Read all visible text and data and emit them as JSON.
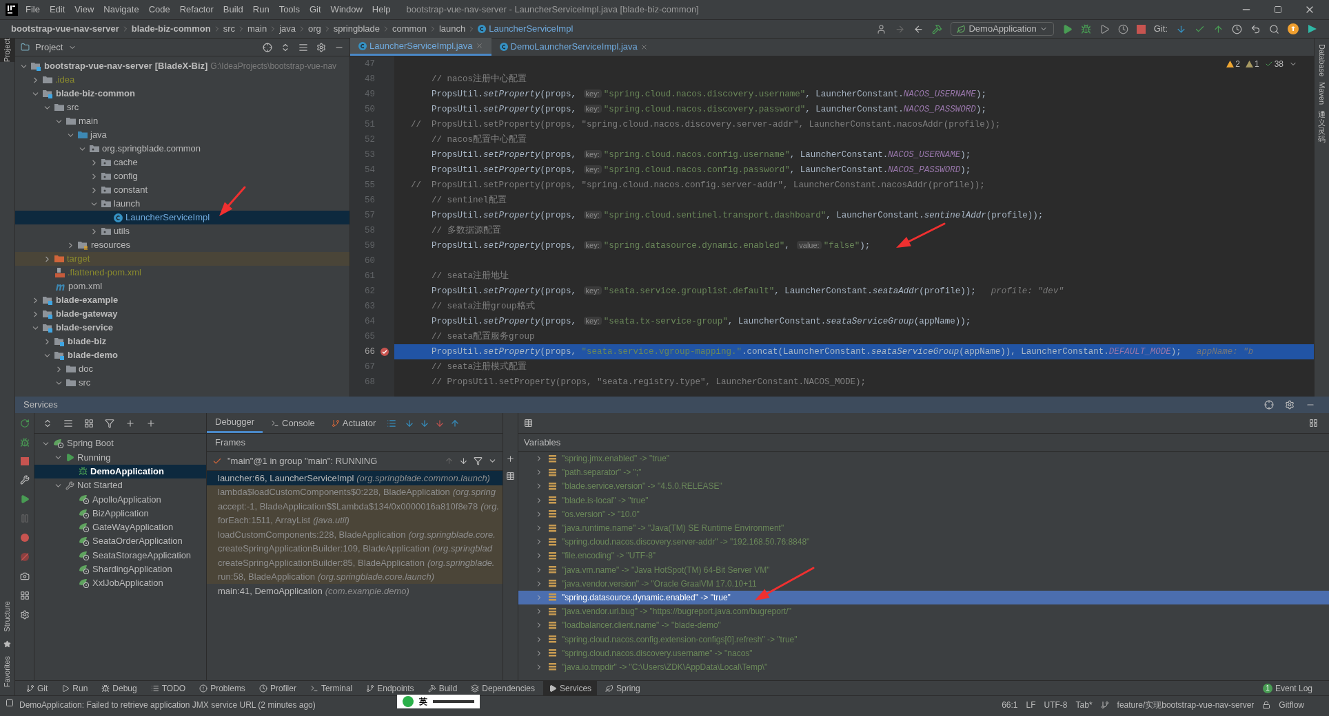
{
  "menu": [
    "File",
    "Edit",
    "View",
    "Navigate",
    "Code",
    "Refactor",
    "Build",
    "Run",
    "Tools",
    "Git",
    "Window",
    "Help"
  ],
  "window": {
    "title": "bootstrap-vue-nav-server - LauncherServiceImpl.java [blade-biz-common]"
  },
  "breadcrumbs": [
    {
      "label": "bootstrap-vue-nav-server",
      "kind": "module"
    },
    {
      "label": "blade-biz-common",
      "kind": "module"
    },
    {
      "label": "src",
      "kind": "dir"
    },
    {
      "label": "main",
      "kind": "dir"
    },
    {
      "label": "java",
      "kind": "dir"
    },
    {
      "label": "org",
      "kind": "dir"
    },
    {
      "label": "springblade",
      "kind": "dir"
    },
    {
      "label": "common",
      "kind": "dir"
    },
    {
      "label": "launch",
      "kind": "dir"
    },
    {
      "label": "LauncherServiceImpl",
      "kind": "class"
    }
  ],
  "run_config": "DemoApplication",
  "git_label": "Git:",
  "side_left": [
    "Project",
    "Structure",
    "Favorites"
  ],
  "side_right": [
    {
      "label": "Database",
      "kind": "latin"
    },
    {
      "label": "Maven",
      "kind": "latin"
    },
    {
      "label": "通义灵码",
      "kind": "cjk"
    }
  ],
  "project": {
    "title": "Project",
    "tree": [
      {
        "label": "bootstrap-vue-nav-server",
        "tag": "[BladeX-Biz]",
        "path": "G:\\IdeaProjects\\bootstrap-vue-nav",
        "kind": "module",
        "expanded": true,
        "selected": false,
        "children": [
          {
            "label": ".idea",
            "kind": "ignored",
            "expanded": false,
            "selected": false
          },
          {
            "label": "blade-biz-common",
            "kind": "module",
            "expanded": true,
            "selected": false,
            "children": [
              {
                "label": "src",
                "kind": "folder",
                "expanded": true,
                "selected": false,
                "children": [
                  {
                    "label": "main",
                    "kind": "folder",
                    "expanded": true,
                    "selected": false,
                    "children": [
                      {
                        "label": "java",
                        "kind": "source",
                        "expanded": true,
                        "selected": false,
                        "children": [
                          {
                            "label": "org.springblade.common",
                            "kind": "package",
                            "expanded": true,
                            "selected": false,
                            "children": [
                              {
                                "label": "cache",
                                "kind": "package",
                                "expanded": false,
                                "selected": false
                              },
                              {
                                "label": "config",
                                "kind": "package",
                                "expanded": false,
                                "selected": false
                              },
                              {
                                "label": "constant",
                                "kind": "package",
                                "expanded": false,
                                "selected": false
                              },
                              {
                                "label": "launch",
                                "kind": "package",
                                "expanded": true,
                                "selected": false,
                                "children": [
                                  {
                                    "label": "LauncherServiceImpl",
                                    "kind": "class",
                                    "selected": true
                                  }
                                ]
                              },
                              {
                                "label": "utils",
                                "kind": "package",
                                "expanded": false,
                                "selected": false
                              }
                            ]
                          }
                        ]
                      },
                      {
                        "label": "resources",
                        "kind": "resources",
                        "expanded": false,
                        "selected": false
                      }
                    ]
                  }
                ]
              },
              {
                "label": "target",
                "kind": "excluded",
                "expanded": false,
                "selected": false
              },
              {
                "label": ".flattened-pom.xml",
                "kind": "xml",
                "selected": false
              },
              {
                "label": "pom.xml",
                "kind": "maven",
                "selected": false
              }
            ]
          },
          {
            "label": "blade-example",
            "kind": "module",
            "expanded": false,
            "selected": false
          },
          {
            "label": "blade-gateway",
            "kind": "module",
            "expanded": false,
            "selected": false
          },
          {
            "label": "blade-service",
            "kind": "module",
            "expanded": true,
            "selected": false,
            "children": [
              {
                "label": "blade-biz",
                "kind": "module",
                "expanded": false,
                "selected": false
              },
              {
                "label": "blade-demo",
                "kind": "module",
                "expanded": true,
                "selected": false,
                "children": [
                  {
                    "label": "doc",
                    "kind": "folder",
                    "expanded": false,
                    "selected": false
                  },
                  {
                    "label": "src",
                    "kind": "folder",
                    "expanded": true,
                    "selected": false
                  }
                ]
              }
            ]
          }
        ]
      }
    ]
  },
  "editor": {
    "tabs": [
      {
        "label": "LauncherServiceImpl.java",
        "selected": true
      },
      {
        "label": "DemoLauncherServiceImpl.java",
        "selected": false
      }
    ],
    "inspections": [
      {
        "count": "2",
        "kind": "warning"
      },
      {
        "count": "1",
        "kind": "weak"
      },
      {
        "count": "38",
        "kind": "ok"
      }
    ],
    "lines": [
      {
        "n": "47",
        "breakpoint": false,
        "selected": false
      },
      {
        "n": "48",
        "breakpoint": false,
        "selected": false,
        "segs": [
          {
            "t": "    // nacos注册中心配置",
            "kind": "comment"
          }
        ]
      },
      {
        "n": "49",
        "breakpoint": false,
        "selected": false,
        "segs": [
          {
            "t": "    PropsUtil.",
            "kind": "plain"
          },
          {
            "t": "setProperty",
            "kind": "method"
          },
          {
            "t": "(props, ",
            "kind": "plain"
          },
          {
            "t": "key:",
            "kind": "hint"
          },
          {
            "t": "\"spring.cloud.nacos.discovery.username\"",
            "kind": "string"
          },
          {
            "t": ", LauncherConstant.",
            "kind": "plain"
          },
          {
            "t": "NACOS_USERNAME",
            "kind": "const"
          },
          {
            "t": ");",
            "kind": "plain"
          }
        ]
      },
      {
        "n": "50",
        "breakpoint": false,
        "selected": false,
        "segs": [
          {
            "t": "    PropsUtil.",
            "kind": "plain"
          },
          {
            "t": "setProperty",
            "kind": "method"
          },
          {
            "t": "(props, ",
            "kind": "plain"
          },
          {
            "t": "key:",
            "kind": "hint"
          },
          {
            "t": "\"spring.cloud.nacos.discovery.password\"",
            "kind": "string"
          },
          {
            "t": ", LauncherConstant.",
            "kind": "plain"
          },
          {
            "t": "NACOS_PASSWORD",
            "kind": "const"
          },
          {
            "t": ");",
            "kind": "plain"
          }
        ]
      },
      {
        "n": "51",
        "breakpoint": false,
        "selected": false,
        "segs": [
          {
            "t": "//  PropsUtil.setProperty(props, \"spring.cloud.nacos.discovery.server-addr\", LauncherConstant.nacosAddr(profile));",
            "kind": "comment"
          }
        ]
      },
      {
        "n": "52",
        "breakpoint": false,
        "selected": false,
        "segs": [
          {
            "t": "    // nacos配置中心配置",
            "kind": "comment"
          }
        ]
      },
      {
        "n": "53",
        "breakpoint": false,
        "selected": false,
        "segs": [
          {
            "t": "    PropsUtil.",
            "kind": "plain"
          },
          {
            "t": "setProperty",
            "kind": "method"
          },
          {
            "t": "(props, ",
            "kind": "plain"
          },
          {
            "t": "key:",
            "kind": "hint"
          },
          {
            "t": "\"spring.cloud.nacos.config.username\"",
            "kind": "string"
          },
          {
            "t": ", LauncherConstant.",
            "kind": "plain"
          },
          {
            "t": "NACOS_USERNAME",
            "kind": "const"
          },
          {
            "t": ");",
            "kind": "plain"
          }
        ]
      },
      {
        "n": "54",
        "breakpoint": false,
        "selected": false,
        "segs": [
          {
            "t": "    PropsUtil.",
            "kind": "plain"
          },
          {
            "t": "setProperty",
            "kind": "method"
          },
          {
            "t": "(props, ",
            "kind": "plain"
          },
          {
            "t": "key:",
            "kind": "hint"
          },
          {
            "t": "\"spring.cloud.nacos.config.password\"",
            "kind": "string"
          },
          {
            "t": ", LauncherConstant.",
            "kind": "plain"
          },
          {
            "t": "NACOS_PASSWORD",
            "kind": "const"
          },
          {
            "t": ");",
            "kind": "plain"
          }
        ]
      },
      {
        "n": "55",
        "breakpoint": false,
        "selected": false,
        "segs": [
          {
            "t": "//  PropsUtil.setProperty(props, \"spring.cloud.nacos.config.server-addr\", LauncherConstant.nacosAddr(profile));",
            "kind": "comment"
          }
        ]
      },
      {
        "n": "56",
        "breakpoint": false,
        "selected": false,
        "segs": [
          {
            "t": "    // sentinel配置",
            "kind": "comment"
          }
        ]
      },
      {
        "n": "57",
        "breakpoint": false,
        "selected": false,
        "segs": [
          {
            "t": "    PropsUtil.",
            "kind": "plain"
          },
          {
            "t": "setProperty",
            "kind": "method"
          },
          {
            "t": "(props, ",
            "kind": "plain"
          },
          {
            "t": "key:",
            "kind": "hint"
          },
          {
            "t": "\"spring.cloud.sentinel.transport.dashboard\"",
            "kind": "string"
          },
          {
            "t": ", LauncherConstant.",
            "kind": "plain"
          },
          {
            "t": "sentinelAddr",
            "kind": "method"
          },
          {
            "t": "(profile));",
            "kind": "plain"
          }
        ]
      },
      {
        "n": "58",
        "breakpoint": false,
        "selected": false,
        "segs": [
          {
            "t": "    // 多数据源配置",
            "kind": "comment"
          }
        ]
      },
      {
        "n": "59",
        "breakpoint": false,
        "selected": false,
        "segs": [
          {
            "t": "    PropsUtil.",
            "kind": "plain"
          },
          {
            "t": "setProperty",
            "kind": "method"
          },
          {
            "t": "(props, ",
            "kind": "plain"
          },
          {
            "t": "key:",
            "kind": "hint"
          },
          {
            "t": "\"spring.datasource.dynamic.enabled\"",
            "kind": "string"
          },
          {
            "t": ", ",
            "kind": "plain"
          },
          {
            "t": "value:",
            "kind": "hint"
          },
          {
            "t": "\"false\"",
            "kind": "string"
          },
          {
            "t": ");",
            "kind": "plain"
          }
        ]
      },
      {
        "n": "60",
        "breakpoint": false,
        "selected": false
      },
      {
        "n": "61",
        "breakpoint": false,
        "selected": false,
        "segs": [
          {
            "t": "    // seata注册地址",
            "kind": "comment"
          }
        ]
      },
      {
        "n": "62",
        "breakpoint": false,
        "selected": false,
        "segs": [
          {
            "t": "    PropsUtil.",
            "kind": "plain"
          },
          {
            "t": "setProperty",
            "kind": "method"
          },
          {
            "t": "(props, ",
            "kind": "plain"
          },
          {
            "t": "key:",
            "kind": "hint"
          },
          {
            "t": "\"seata.service.grouplist.default\"",
            "kind": "string"
          },
          {
            "t": ", LauncherConstant.",
            "kind": "plain"
          },
          {
            "t": "seataAddr",
            "kind": "method"
          },
          {
            "t": "(profile));",
            "kind": "plain"
          },
          {
            "t": "profile: \"dev\"",
            "kind": "inline"
          }
        ]
      },
      {
        "n": "63",
        "breakpoint": false,
        "selected": false,
        "segs": [
          {
            "t": "    // seata注册group格式",
            "kind": "comment"
          }
        ]
      },
      {
        "n": "64",
        "breakpoint": false,
        "selected": false,
        "segs": [
          {
            "t": "    PropsUtil.",
            "kind": "plain"
          },
          {
            "t": "setProperty",
            "kind": "method"
          },
          {
            "t": "(props, ",
            "kind": "plain"
          },
          {
            "t": "key:",
            "kind": "hint"
          },
          {
            "t": "\"seata.tx-service-group\"",
            "kind": "string"
          },
          {
            "t": ", LauncherConstant.",
            "kind": "plain"
          },
          {
            "t": "seataServiceGroup",
            "kind": "method"
          },
          {
            "t": "(appName));",
            "kind": "plain"
          }
        ]
      },
      {
        "n": "65",
        "breakpoint": false,
        "selected": false,
        "segs": [
          {
            "t": "    // seata配置服务group",
            "kind": "comment"
          }
        ]
      },
      {
        "n": "66",
        "breakpoint": true,
        "selected": true,
        "segs": [
          {
            "t": "    PropsUtil.",
            "kind": "plain"
          },
          {
            "t": "setProperty",
            "kind": "method"
          },
          {
            "t": "(props, ",
            "kind": "plain"
          },
          {
            "t": "\"seata.service.vgroup-mapping.\"",
            "kind": "string"
          },
          {
            "t": ".concat(LauncherConstant.",
            "kind": "plain"
          },
          {
            "t": "seataServiceGroup",
            "kind": "method"
          },
          {
            "t": "(appName)), LauncherConstant.",
            "kind": "plain"
          },
          {
            "t": "DEFAULT_MODE",
            "kind": "const"
          },
          {
            "t": ");",
            "kind": "plain"
          },
          {
            "t": "appName: \"b",
            "kind": "inline"
          }
        ]
      },
      {
        "n": "67",
        "breakpoint": false,
        "selected": false,
        "segs": [
          {
            "t": "    // seata注册模式配置",
            "kind": "comment"
          }
        ]
      },
      {
        "n": "68",
        "breakpoint": false,
        "selected": false,
        "segs": [
          {
            "t": "    // PropsUtil.setProperty(props, \"seata.registry.type\", LauncherConstant.NACOS_MODE);",
            "kind": "comment"
          }
        ]
      }
    ]
  },
  "services": {
    "title": "Services",
    "tree": [
      {
        "label": "Spring Boot",
        "kind": "group",
        "expanded": true,
        "selected": false,
        "children": [
          {
            "label": "Running",
            "kind": "running",
            "expanded": true,
            "selected": false,
            "children": [
              {
                "label": "DemoApplication",
                "kind": "debug",
                "selected": true
              }
            ]
          },
          {
            "label": "Not Started",
            "kind": "stopped",
            "expanded": true,
            "selected": false,
            "children": [
              {
                "label": "ApolloApplication",
                "kind": "app",
                "selected": false
              },
              {
                "label": "BizApplication",
                "kind": "app",
                "selected": false
              },
              {
                "label": "GateWayApplication",
                "kind": "app",
                "selected": false
              },
              {
                "label": "SeataOrderApplication",
                "kind": "app",
                "selected": false
              },
              {
                "label": "SeataStorageApplication",
                "kind": "app",
                "selected": false
              },
              {
                "label": "ShardingApplication",
                "kind": "app",
                "selected": false
              },
              {
                "label": "XxlJobApplication",
                "kind": "app",
                "selected": false
              }
            ]
          }
        ]
      }
    ]
  },
  "debugger": {
    "tabs": [
      {
        "label": "Debugger",
        "kind": "debugger",
        "selected": true
      },
      {
        "label": "Console",
        "kind": "console",
        "selected": false
      },
      {
        "label": "Actuator",
        "kind": "actuator",
        "selected": false
      }
    ],
    "frames_title": "Frames",
    "thread": "\"main\"@1 in group \"main\": RUNNING",
    "frames": [
      {
        "method": "launcher:66, LauncherServiceImpl",
        "pkg": "(org.springblade.common.launch)",
        "kind": "user",
        "selected": true
      },
      {
        "method": "lambda$loadCustomComponents$0:228, BladeApplication",
        "pkg": "(org.spring",
        "kind": "library",
        "selected": false
      },
      {
        "method": "accept:-1, BladeApplication$$Lambda$134/0x0000016a810f8e78",
        "pkg": "(org.",
        "kind": "library",
        "selected": false
      },
      {
        "method": "forEach:1511, ArrayList",
        "pkg": "(java.util)",
        "kind": "library",
        "selected": false
      },
      {
        "method": "loadCustomComponents:228, BladeApplication",
        "pkg": "(org.springblade.core.",
        "kind": "library",
        "selected": false
      },
      {
        "method": "createSpringApplicationBuilder:109, BladeApplication",
        "pkg": "(org.springblad",
        "kind": "library",
        "selected": false
      },
      {
        "method": "createSpringApplicationBuilder:85, BladeApplication",
        "pkg": "(org.springblade.",
        "kind": "library",
        "selected": false
      },
      {
        "method": "run:58, BladeApplication",
        "pkg": "(org.springblade.core.launch)",
        "kind": "library",
        "selected": false
      },
      {
        "method": "main:41, DemoApplication",
        "pkg": "(com.example.demo)",
        "kind": "user",
        "selected": false
      }
    ],
    "variables_title": "Variables",
    "variables": [
      {
        "text": "\"spring.jmx.enabled\" -> \"true\"",
        "selected": false
      },
      {
        "text": "\"path.separator\" -> \";\"",
        "selected": false
      },
      {
        "text": "\"blade.service.version\" -> \"4.5.0.RELEASE\"",
        "selected": false
      },
      {
        "text": "\"blade.is-local\" -> \"true\"",
        "selected": false
      },
      {
        "text": "\"os.version\" -> \"10.0\"",
        "selected": false
      },
      {
        "text": "\"java.runtime.name\" -> \"Java(TM) SE Runtime Environment\"",
        "selected": false
      },
      {
        "text": "\"spring.cloud.nacos.discovery.server-addr\" -> \"192.168.50.76:8848\"",
        "selected": false
      },
      {
        "text": "\"file.encoding\" -> \"UTF-8\"",
        "selected": false
      },
      {
        "text": "\"java.vm.name\" -> \"Java HotSpot(TM) 64-Bit Server VM\"",
        "selected": false
      },
      {
        "text": "\"java.vendor.version\" -> \"Oracle GraalVM 17.0.10+11",
        "selected": false
      },
      {
        "text": "\"spring.datasource.dynamic.enabled\" -> \"true\"",
        "selected": true
      },
      {
        "text": "\"java.vendor.url.bug\" -> \"https://bugreport.java.com/bugreport/\"",
        "selected": false
      },
      {
        "text": "\"loadbalancer.client.name\" -> \"blade-demo\"",
        "selected": false
      },
      {
        "text": "\"spring.cloud.nacos.config.extension-configs[0].refresh\" -> \"true\"",
        "selected": false
      },
      {
        "text": "\"spring.cloud.nacos.discovery.username\" -> \"nacos\"",
        "selected": false
      },
      {
        "text": "\"java.io.tmpdir\" -> \"C:\\Users\\ZDK\\AppData\\Local\\Temp\\\"",
        "selected": false
      }
    ]
  },
  "tool_windows": [
    {
      "label": "Git",
      "kind": "git",
      "selected": false
    },
    {
      "label": "Run",
      "kind": "run",
      "selected": false
    },
    {
      "label": "Debug",
      "kind": "debug",
      "selected": false
    },
    {
      "label": "TODO",
      "kind": "todo",
      "selected": false
    },
    {
      "label": "Problems",
      "kind": "problems",
      "selected": false
    },
    {
      "label": "Profiler",
      "kind": "profiler",
      "selected": false
    },
    {
      "label": "Terminal",
      "kind": "terminal",
      "selected": false
    },
    {
      "label": "Endpoints",
      "kind": "endpoints",
      "selected": false
    },
    {
      "label": "Build",
      "kind": "build",
      "selected": false
    },
    {
      "label": "Dependencies",
      "kind": "deps",
      "selected": false
    },
    {
      "label": "Services",
      "kind": "services",
      "selected": true
    },
    {
      "label": "Spring",
      "kind": "spring",
      "selected": false
    }
  ],
  "event_log": {
    "count": "1",
    "label": "Event Log"
  },
  "status": {
    "message": "DemoApplication: Failed to retrieve application JMX service URL (2 minutes ago)",
    "ime": "英",
    "items": [
      "66:1",
      "LF",
      "UTF-8",
      "Tab*"
    ],
    "branch": "feature/实现bootstrap-vue-nav-server",
    "gitflow": "Gitflow"
  }
}
